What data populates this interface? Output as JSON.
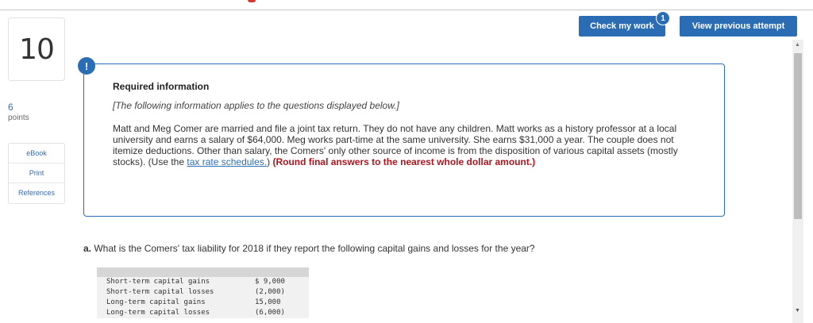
{
  "question": {
    "number": "10",
    "points_value": "6",
    "points_label": "points"
  },
  "tools": [
    {
      "label": "eBook"
    },
    {
      "label": "Print"
    },
    {
      "label": "References"
    }
  ],
  "header": {
    "check_label": "Check my work",
    "badge_count": "1",
    "prev_label": "View previous attempt"
  },
  "info": {
    "alert_glyph": "!",
    "title": "Required information",
    "subtitle": "[The following information applies to the questions displayed below.]",
    "body": "Matt and Meg Comer are married and file a joint tax return. They do not have any children. Matt works as a history professor at a local university and earns a salary of $64,000. Meg works part-time at the same university. She earns $31,000 a year. The couple does not itemize deductions. Other than salary, the Comers' only other source of income is from the disposition of various capital assets (mostly stocks). (Use the",
    "link": "tax rate schedules.",
    "body_end": ")",
    "note": "(Round final answers to the nearest whole dollar amount.)"
  },
  "part_a": {
    "letter": "a.",
    "text": "What is the Comers' tax liability for 2018 if they report the following capital gains and losses for the year?",
    "rows": [
      {
        "label": "Short-term capital gains",
        "amount": "$ 9,000"
      },
      {
        "label": "Short-term capital losses",
        "amount": " (2,000)"
      },
      {
        "label": "Long-term capital gains",
        "amount": "  15,000"
      },
      {
        "label": "Long-term capital losses",
        "amount": " (6,000)"
      }
    ]
  },
  "colors": {
    "accent": "#2b6db4",
    "note_red": "#b5121b"
  }
}
